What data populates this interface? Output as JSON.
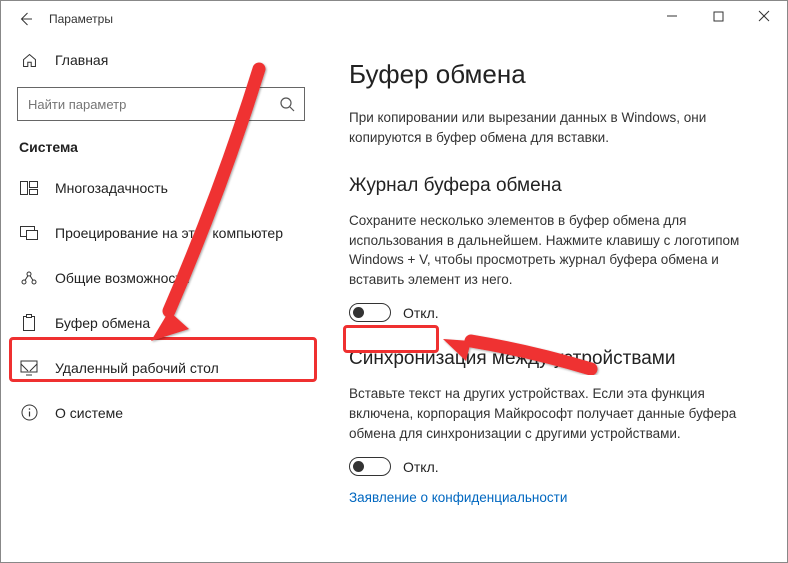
{
  "titlebar": {
    "app_title": "Параметры"
  },
  "home": {
    "label": "Главная"
  },
  "search": {
    "placeholder": "Найти параметр"
  },
  "section_header": "Система",
  "nav": {
    "multitasking": "Многозадачность",
    "projecting": "Проецирование на этот компьютер",
    "shared": "Общие возможности",
    "clipboard": "Буфер обмена",
    "remote": "Удаленный рабочий стол",
    "about": "О системе"
  },
  "content": {
    "page_title": "Буфер обмена",
    "intro": "При копировании или вырезании данных в Windows, они копируются в буфер обмена для вставки.",
    "history_title": "Журнал буфера обмена",
    "history_desc": "Сохраните несколько элементов в буфер обмена для использования в дальнейшем. Нажмите клавишу с логотипом Windows + V, чтобы просмотреть журнал буфера обмена и вставить элемент из него.",
    "toggle_off": "Откл.",
    "sync_title": "Синхронизация между устройствами",
    "sync_desc": "Вставьте текст на других устройствах. Если эта функция включена, корпорация Майкрософт получает данные буфера обмена для синхронизации с другими устройствами.",
    "privacy_link": "Заявление о конфиденциальности"
  }
}
